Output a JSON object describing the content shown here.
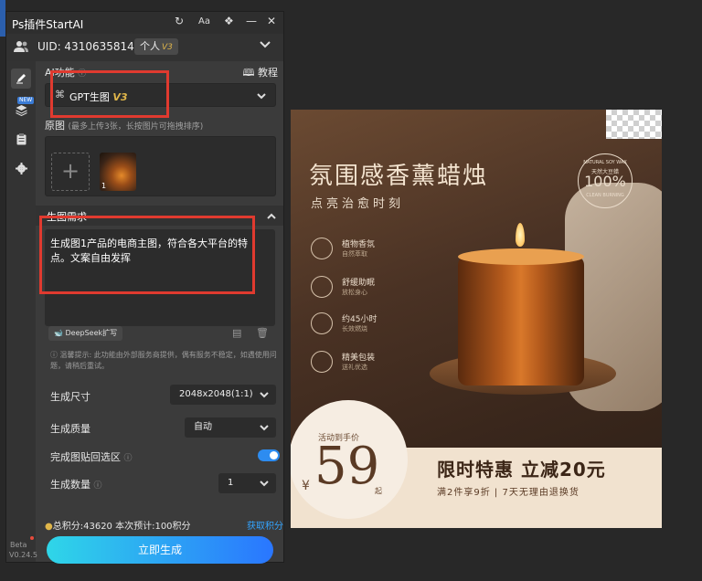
{
  "plugin": {
    "title": "Ps插件StartAI",
    "uid_text": "UID: 4310635814",
    "plan_label": "个人",
    "plan_version": "V3",
    "ai_function_label": "AI功能",
    "tutorial_label": "教程",
    "model_value": "GPT生图",
    "model_version": "V3",
    "source_image_label": "原图",
    "source_image_hint": "(最多上传3张，长按图片可拖拽排序)",
    "thumb_index": "1",
    "requirement_label": "生图需求",
    "prompt_text": "生成图1产品的电商主图，符合各大平台的特点。文案自由发挥",
    "deepseek_label": "DeepSeek扩写",
    "notice_text": "温馨提示: 此功能由外部服务商提供，偶有服务不稳定，如遇使用问题，请稍后重试。",
    "size_label": "生成尺寸",
    "size_value": "2048x2048(1:1)",
    "quality_label": "生成质量",
    "quality_value": "自动",
    "paste_back_label": "完成图贴回选区",
    "paste_back_on": true,
    "count_label": "生成数量",
    "count_value": "1",
    "points_text": "总积分:43620  本次预计:100积分",
    "get_points_label": "获取积分",
    "generate_label": "立即生成",
    "beta_label": "Beta",
    "version_label": "V0.24.5",
    "new_badge": "NEW"
  },
  "poster": {
    "title": "氛围感香薰蜡烛",
    "subtitle": "点亮治愈时刻",
    "seal_top": "NATURAL SOY WAX",
    "seal_mid": "天然大豆蜡",
    "seal_pct": "100%",
    "seal_bottom": "CLEAN BURNING",
    "features": [
      {
        "title": "植物香氛",
        "sub": "自然萃取"
      },
      {
        "title": "舒缓助眠",
        "sub": "放松身心"
      },
      {
        "title": "约45小时",
        "sub": "长效燃烧"
      },
      {
        "title": "精美包装",
        "sub": "送礼优选"
      }
    ],
    "price_label": "活动到手价",
    "price_currency": "¥",
    "price_value": "59",
    "price_suffix": "起",
    "promo_title": "限时特惠  立减20元",
    "promo_sub": "满2件享9折  |  7天无理由退换货"
  },
  "colors": {
    "accent_blue": "#2d8cf0",
    "annotation_red": "#e03a2f",
    "version_gold": "#e0b64a"
  }
}
